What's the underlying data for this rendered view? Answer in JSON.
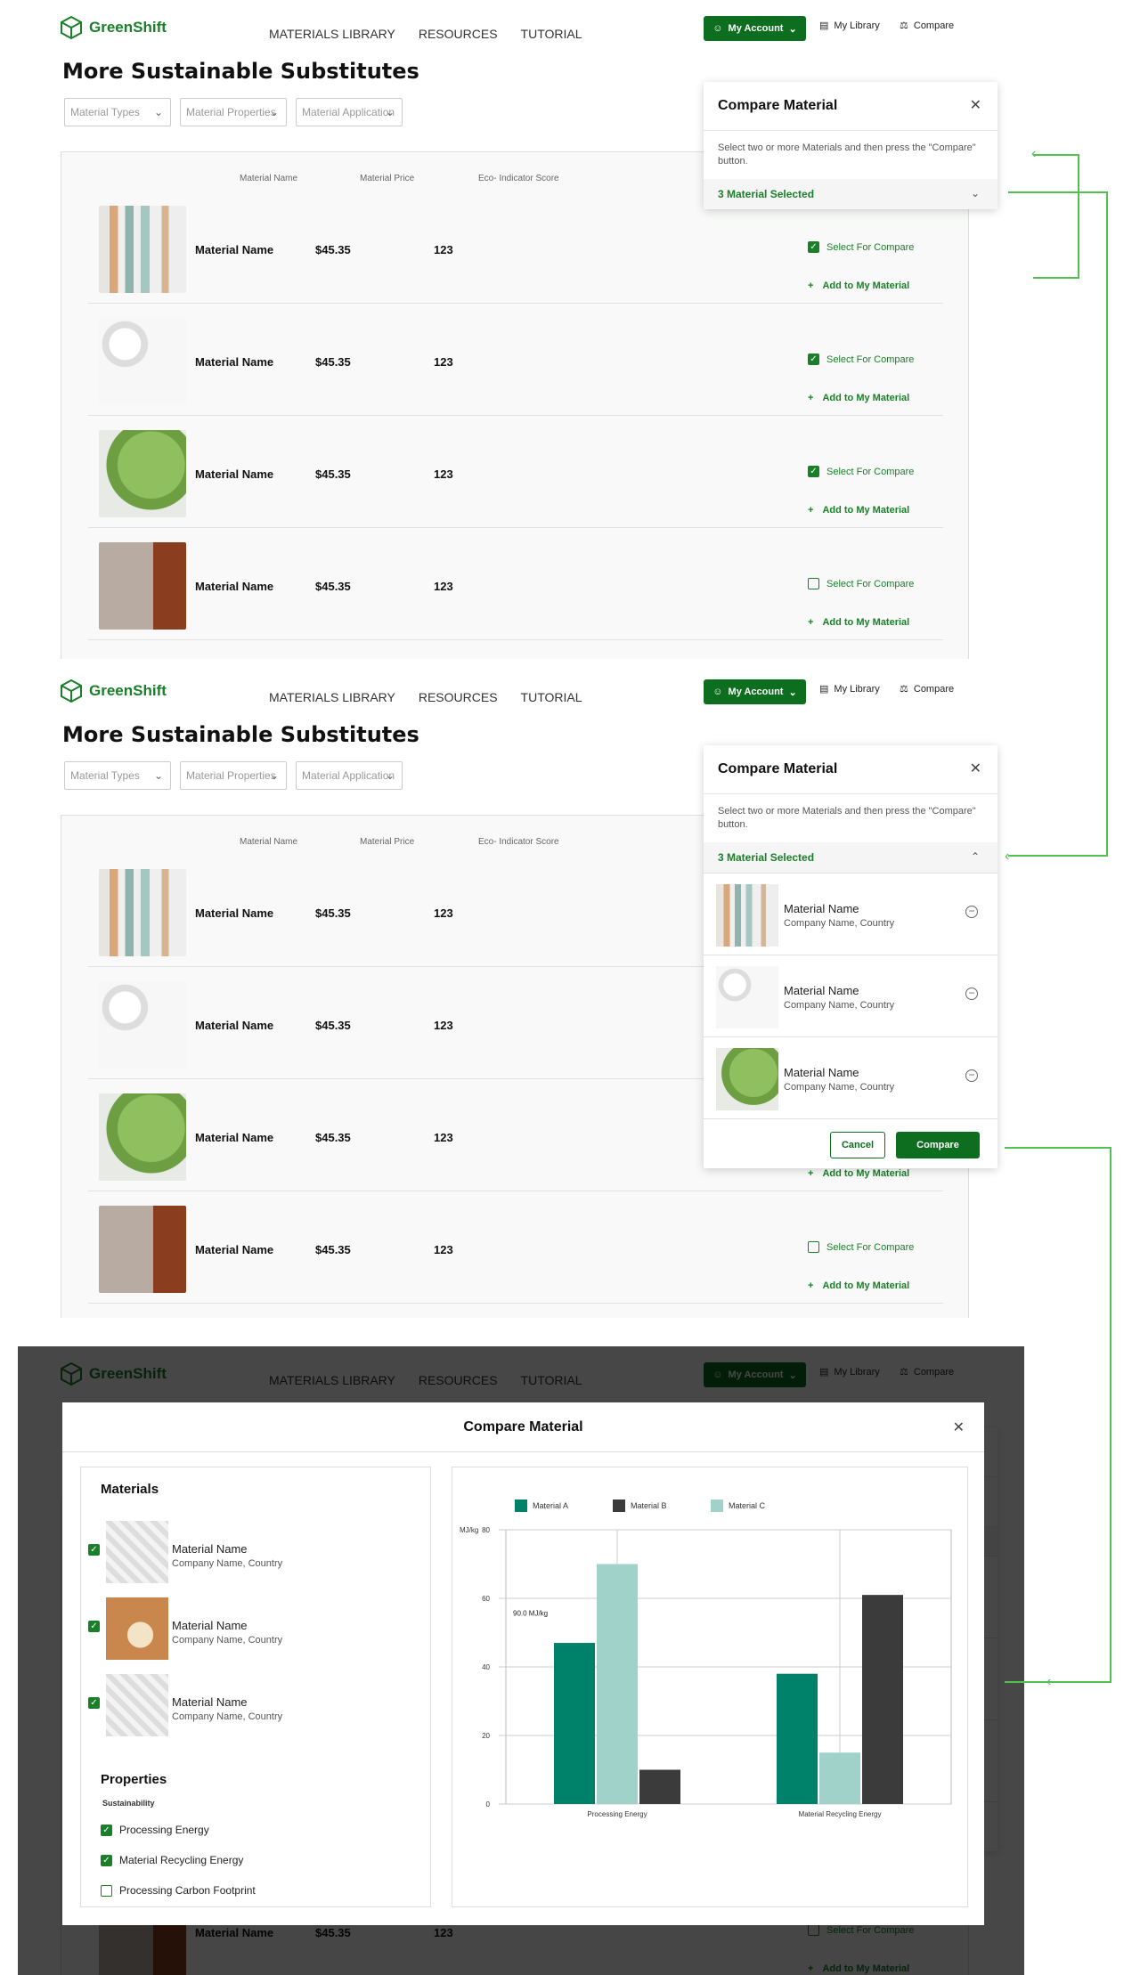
{
  "brand": "GreenShift",
  "nav": {
    "items": [
      "MATERIALS LIBRARY",
      "RESOURCES",
      "TUTORIAL"
    ],
    "account": "My Account",
    "library": "My Library",
    "compare": "Compare"
  },
  "page_title": "More Sustainable Substitutes",
  "filters": [
    "Material Types",
    "Material Properties",
    "Material Application"
  ],
  "table": {
    "headers": [
      "Material Name",
      "Material Price",
      "Eco- Indicator Score"
    ],
    "rows": [
      {
        "name": "Material Name",
        "price": "$45.35",
        "score": "123",
        "selected": true
      },
      {
        "name": "Material Name",
        "price": "$45.35",
        "score": "123",
        "selected": true
      },
      {
        "name": "Material Name",
        "price": "$45.35",
        "score": "123",
        "selected": true
      },
      {
        "name": "Material Name",
        "price": "$45.35",
        "score": "123",
        "selected": false
      }
    ],
    "select_label": "Select For Compare",
    "add_label": "Add to My Material"
  },
  "compare_panel": {
    "title": "Compare Material",
    "description": "Select two or more Materials and then press the \"Compare\" button.",
    "selected_count": "3 Material Selected",
    "items": [
      {
        "name": "Material Name",
        "company": "Company Name, Country"
      },
      {
        "name": "Material Name",
        "company": "Company Name, Country"
      },
      {
        "name": "Material Name",
        "company": "Company Name, Country"
      }
    ],
    "cancel": "Cancel",
    "compare": "Compare"
  },
  "compare_modal": {
    "title": "Compare Material",
    "materials_heading": "Materials",
    "materials": [
      {
        "name": "Material Name",
        "company": "Company Name, Country"
      },
      {
        "name": "Material Name",
        "company": "Company Name, Country"
      },
      {
        "name": "Material Name",
        "company": "Company Name, Country"
      }
    ],
    "properties_heading": "Properties",
    "properties_group": "Sustainability",
    "properties": [
      {
        "label": "Processing Energy",
        "checked": true
      },
      {
        "label": "Material Recycling Energy",
        "checked": true
      },
      {
        "label": "Processing Carbon Footprint",
        "checked": false
      }
    ]
  },
  "chart_data": {
    "type": "bar",
    "categories": [
      "Processing Energy",
      "Material Recycling Energy"
    ],
    "series": [
      {
        "name": "Material A",
        "color": "#00816a",
        "values": [
          47,
          38
        ]
      },
      {
        "name": "Material C",
        "color": "#a1d2c9",
        "values": [
          70,
          15
        ]
      },
      {
        "name": "Material B",
        "color": "#3b3b3b",
        "values": [
          10,
          61
        ]
      }
    ],
    "legend_order": [
      "Material A",
      "Material B",
      "Material C"
    ],
    "ylabel": "MJ/kg",
    "ylim": [
      0,
      80
    ],
    "yticks": [
      0,
      20,
      40,
      60,
      80
    ],
    "annotation": "90.0 MJ/kg",
    "grid": true
  }
}
